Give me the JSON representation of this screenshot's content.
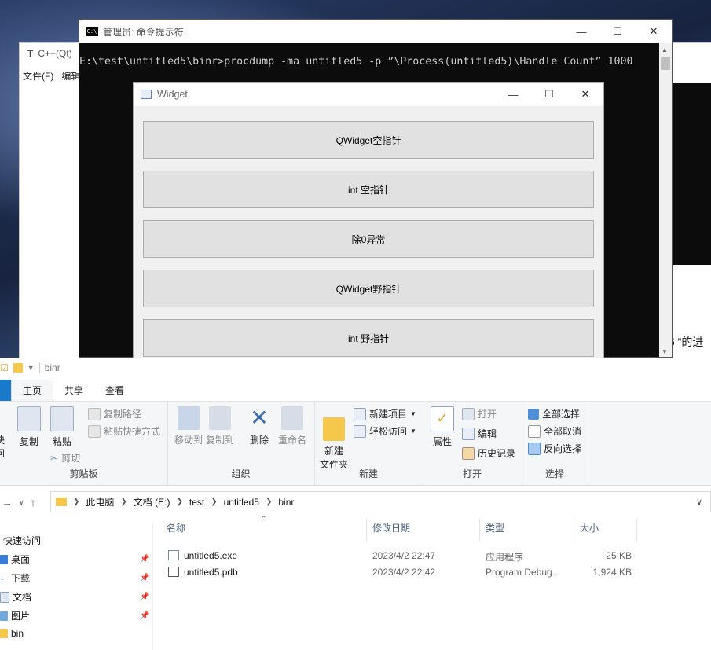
{
  "editor": {
    "title": "C++(Qt)",
    "menu": [
      "文件(F)",
      "编辑"
    ],
    "trailing_text": "5 ”的进"
  },
  "cmd": {
    "title": "管理员: 命令提示符",
    "icon_text": "C:\\",
    "line": "E:\\test\\untitled5\\binr>procdump -ma untitled5 -p ”\\Process(untitled5)\\Handle Count” 1000"
  },
  "widget": {
    "title": "Widget",
    "buttons": [
      "QWidget空指针",
      "int 空指针",
      "除0异常",
      "QWidget野指针",
      "int 野指针"
    ]
  },
  "explorer": {
    "qat_title": "binr",
    "tabs": [
      "主页",
      "共享",
      "查看"
    ],
    "ribbon": {
      "clipboard": {
        "label": "剪贴板",
        "pin_partial": "快\n问",
        "copy": "复制",
        "paste": "粘贴",
        "copy_path": "复制路径",
        "paste_shortcut": "粘贴快捷方式",
        "cut": "剪切"
      },
      "organize": {
        "label": "组织",
        "move_to": "移动到",
        "copy_to": "复制到",
        "delete": "删除",
        "rename": "重命名"
      },
      "new": {
        "label": "新建",
        "new_folder": "新建\n文件夹",
        "new_item": "新建项目",
        "easy_access": "轻松访问"
      },
      "open": {
        "label": "打开",
        "properties": "属性",
        "open": "打开",
        "edit": "编辑",
        "history": "历史记录"
      },
      "select": {
        "label": "选择",
        "select_all": "全部选择",
        "select_none": "全部取消",
        "invert": "反向选择"
      }
    },
    "breadcrumb": [
      "此电脑",
      "文档 (E:)",
      "test",
      "untitled5",
      "binr"
    ],
    "nav": [
      {
        "label": "快速访问",
        "pinned": false
      },
      {
        "label": "桌面",
        "pinned": true
      },
      {
        "label": "下载",
        "pinned": true
      },
      {
        "label": "文档",
        "pinned": true
      },
      {
        "label": "图片",
        "pinned": true
      },
      {
        "label": "bin",
        "pinned": false
      }
    ],
    "columns": {
      "name": "名称",
      "date": "修改日期",
      "type": "类型",
      "size": "大小"
    },
    "files": [
      {
        "name": "untitled5.exe",
        "date": "2023/4/2 22:47",
        "type": "应用程序",
        "size": "25 KB"
      },
      {
        "name": "untitled5.pdb",
        "date": "2023/4/2 22:42",
        "type": "Program Debug...",
        "size": "1,924 KB"
      }
    ]
  }
}
